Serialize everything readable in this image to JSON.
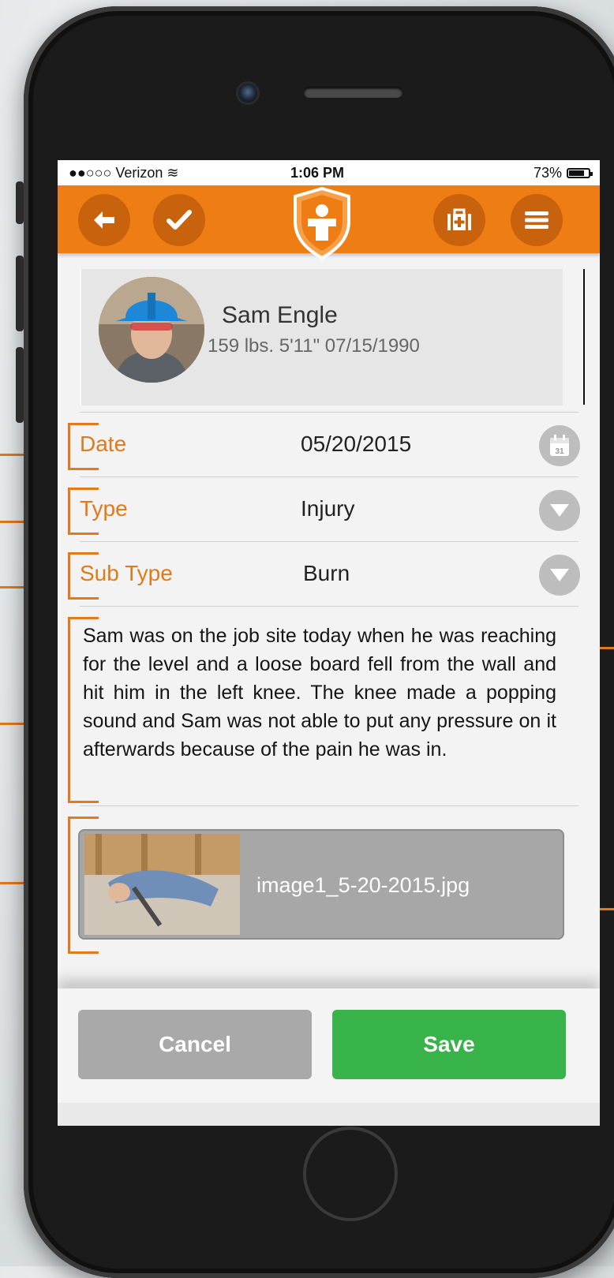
{
  "status_bar": {
    "carrier": "●●○○○ Verizon ≋",
    "time": "1:06 PM",
    "battery": "73%",
    "battery_level": 0.73
  },
  "app_bar": {
    "back_icon": "arrow-left-icon",
    "check_icon": "checkmark-icon",
    "logo_icon": "shield-person-logo",
    "firstaid_icon": "first-aid-kit-icon",
    "menu_icon": "hamburger-menu-icon",
    "accent_color": "#ee7d14"
  },
  "profile": {
    "name": "Sam Engle",
    "stats": "159 lbs. 5'11\" 07/15/1990"
  },
  "form": {
    "date": {
      "label": "Date",
      "value": "05/20/2015",
      "icon": "calendar-icon",
      "icon_text": "31"
    },
    "type": {
      "label": "Type",
      "value": "Injury",
      "icon": "dropdown-icon"
    },
    "subtype": {
      "label": "Sub Type",
      "value": "Burn",
      "icon": "dropdown-icon"
    },
    "description": "Sam was on the job site today when he was reaching for the level and a loose board fell from the wall and hit him in the left knee. The knee made a popping sound and Sam was not able to put any pressure on it afterwards because of the pain he was in."
  },
  "attachment": {
    "filename": "image1_5-20-2015.jpg"
  },
  "actions": {
    "cancel": "Cancel",
    "save": "Save",
    "save_color": "#37b34a"
  }
}
